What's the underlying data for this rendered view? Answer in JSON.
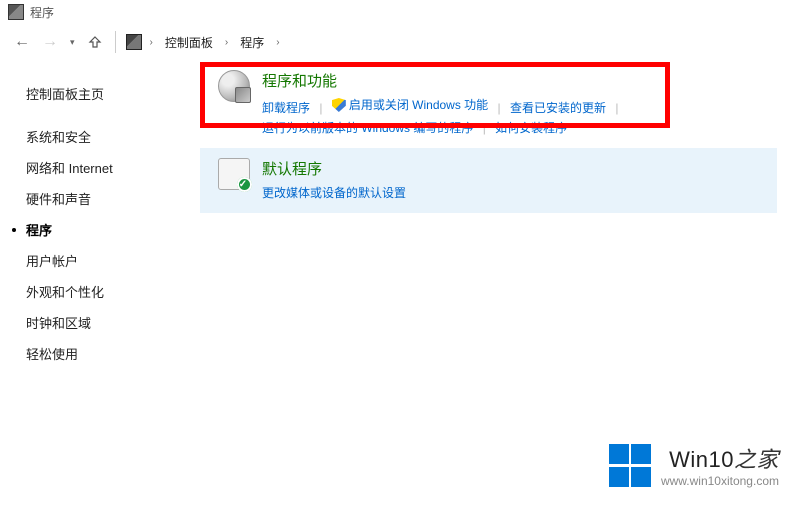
{
  "title": "程序",
  "breadcrumb": {
    "root": "控制面板",
    "current": "程序"
  },
  "sidebar": {
    "home": "控制面板主页",
    "items": [
      {
        "label": "系统和安全"
      },
      {
        "label": "网络和 Internet"
      },
      {
        "label": "硬件和声音"
      },
      {
        "label": "程序",
        "active": true
      },
      {
        "label": "用户帐户"
      },
      {
        "label": "外观和个性化"
      },
      {
        "label": "时钟和区域"
      },
      {
        "label": "轻松使用"
      }
    ]
  },
  "categories": [
    {
      "title": "程序和功能",
      "links": [
        {
          "label": "卸载程序"
        },
        {
          "label": "启用或关闭 Windows 功能",
          "shield": true
        },
        {
          "label": "查看已安装的更新"
        },
        {
          "label": "运行为以前版本的 Windows 编写的程序"
        },
        {
          "label": "如何安装程序"
        }
      ]
    },
    {
      "title": "默认程序",
      "links": [
        {
          "label": "更改媒体或设备的默认设置"
        }
      ]
    }
  ],
  "watermark": {
    "brand_prefix": "Win10",
    "brand_suffix": "之家",
    "url": "www.win10xitong.com"
  }
}
